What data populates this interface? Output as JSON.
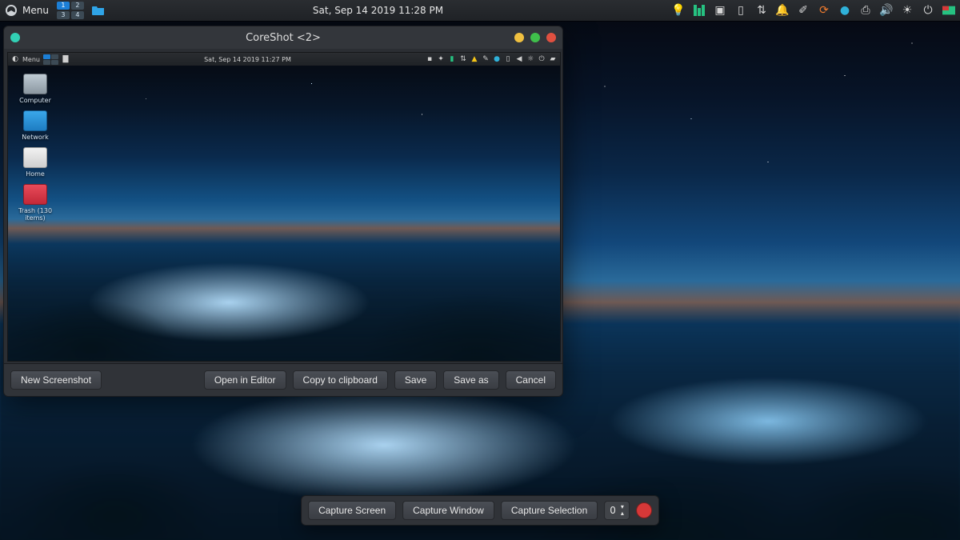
{
  "panel": {
    "menu_label": "Menu",
    "workspaces": [
      "1",
      "2",
      "3",
      "4"
    ],
    "active_workspace": 0,
    "clock": "Sat, Sep 14 2019 11:28 PM",
    "tray_icons": [
      "note-icon",
      "bulb-icon",
      "manjaro-icon",
      "windows-icon",
      "battery-icon",
      "network-icon",
      "bell-icon",
      "brush-icon",
      "refresh-icon",
      "record-icon",
      "usb-icon",
      "volume-icon",
      "brightness-icon",
      "power-icon",
      "monitor-icon"
    ]
  },
  "window": {
    "title": "CoreShot <2>",
    "actions": {
      "new_screenshot": "New Screenshot",
      "open_editor": "Open in Editor",
      "copy_clipboard": "Copy to clipboard",
      "save": "Save",
      "save_as": "Save as",
      "cancel": "Cancel"
    }
  },
  "preview": {
    "mini_clock": "Sat, Sep 14 2019 11:27 PM",
    "mini_menu": "Menu",
    "desktop_icons": {
      "computer": "Computer",
      "network": "Network",
      "home": "Home",
      "trash": "Trash (130 items)"
    }
  },
  "capturebar": {
    "screen": "Capture Screen",
    "window": "Capture Window",
    "selection": "Capture Selection",
    "delay_value": "0"
  },
  "colors": {
    "panel_bg": "#1f2226",
    "accent_green": "#26c281",
    "accent_blue": "#1c7fd6",
    "accent_red": "#d63838"
  }
}
